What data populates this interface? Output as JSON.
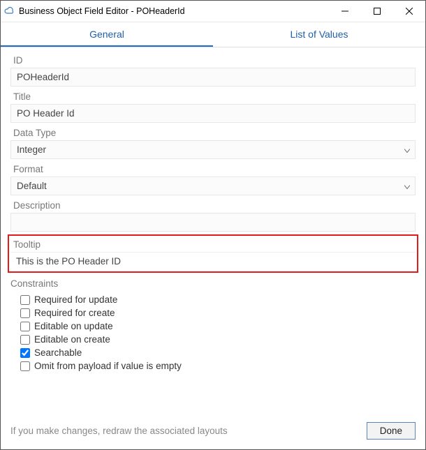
{
  "window": {
    "title": "Business Object Field Editor - POHeaderId"
  },
  "tabs": {
    "general": "General",
    "list_of_values": "List of Values",
    "active": "general"
  },
  "fields": {
    "id": {
      "label": "ID",
      "value": "POHeaderId"
    },
    "title": {
      "label": "Title",
      "value": "PO Header Id"
    },
    "data_type": {
      "label": "Data Type",
      "value": "Integer"
    },
    "format": {
      "label": "Format",
      "value": "Default"
    },
    "description": {
      "label": "Description",
      "value": ""
    },
    "tooltip": {
      "label": "Tooltip",
      "value": "This is the PO Header ID"
    }
  },
  "constraints": {
    "label": "Constraints",
    "items": [
      {
        "label": "Required for update",
        "checked": false
      },
      {
        "label": "Required for create",
        "checked": false
      },
      {
        "label": "Editable on update",
        "checked": false
      },
      {
        "label": "Editable on create",
        "checked": false
      },
      {
        "label": "Searchable",
        "checked": true
      },
      {
        "label": "Omit from payload if value is empty",
        "checked": false
      }
    ]
  },
  "footer": {
    "hint": "If you make changes, redraw the associated layouts",
    "done": "Done"
  }
}
